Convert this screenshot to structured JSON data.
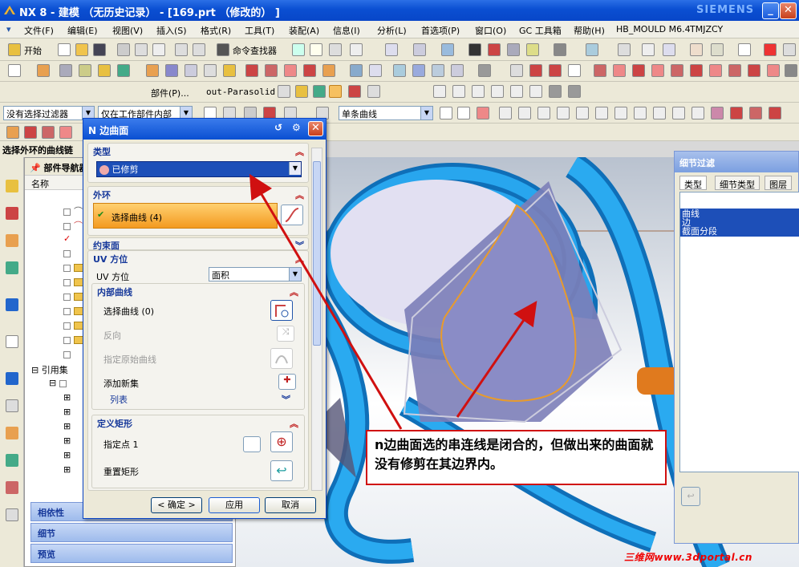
{
  "app": {
    "title": "NX 8 - 建模 （无历史记录） - [169.prt （修改的） ]",
    "brand": "SIEMENS"
  },
  "menu": [
    "文件(F)",
    "编辑(E)",
    "视图(V)",
    "插入(S)",
    "格式(R)",
    "工具(T)",
    "装配(A)",
    "信息(I)",
    "分析(L)",
    "首选项(P)",
    "窗口(O)",
    "GC 工具箱",
    "帮助(H)",
    "HB_MOULD M6.4",
    "TMJZCY"
  ],
  "toolbar": {
    "start_label": "开始",
    "command_finder_label": "命令查找器",
    "part_label": "部件(P)...",
    "parasolid_label": "out-Parasolid"
  },
  "selection": {
    "filter_value": "没有选择过滤器",
    "scope_value": "仅在工作部件内部",
    "curve_rule_value": "单条曲线"
  },
  "cue_line": "选择外环的曲线链",
  "navigator": {
    "title": "部件导航器",
    "col_name": "名称",
    "ref_set_label": "引用集"
  },
  "bottom_panels": [
    "相依性",
    "细节",
    "预览"
  ],
  "dialog": {
    "title": "N 边曲面",
    "type_section": "类型",
    "type_value": "已修剪",
    "outer_loop_section": "外环",
    "select_curve_label": "选择曲线 (4)",
    "constraint_section": "约束面",
    "uv_section": "UV 方位",
    "uv_label": "UV 方位",
    "uv_value": "面积",
    "inner_section": "内部曲线",
    "inner_select_label": "选择曲线 (0)",
    "reverse_label": "反向",
    "orig_curve_label": "指定原始曲线",
    "add_set_label": "添加新集",
    "list_label": "列表",
    "rect_section": "定义矩形",
    "point_label": "指定点 1",
    "reset_label": "重置矩形",
    "ok_label": "< 确定 >",
    "apply_label": "应用",
    "cancel_label": "取消"
  },
  "filter_panel": {
    "title": "细节过滤",
    "tabs": [
      "类型",
      "细节类型",
      "图层"
    ],
    "items": [
      "曲线",
      "边",
      "截面分段"
    ]
  },
  "callout": {
    "text": "n边曲面选的串连线是闭合的，但做出来的曲面就没有修剪在其边界内。"
  },
  "watermark": "三维网www.3dportal.cn",
  "colors": {
    "xp_blue": "#0a4fd2",
    "surface": "#7c7eb8",
    "pipe": "#1e9ee8",
    "orange_curve": "#e89b2c",
    "arrow": "#d01010"
  }
}
